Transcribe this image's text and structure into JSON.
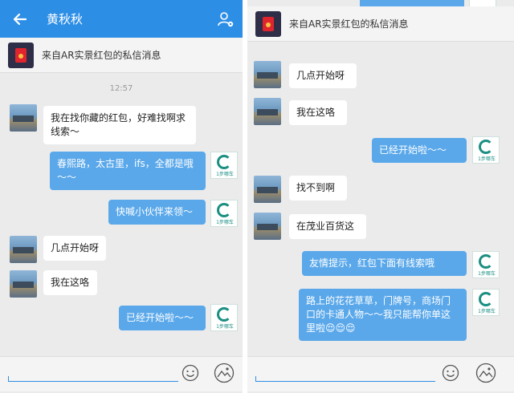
{
  "left": {
    "header": {
      "title": "黄秋秋",
      "back_icon": "arrow-left-icon",
      "contact_icon": "contact-icon"
    },
    "notice": "来自AR实景红包的私信消息",
    "timestamp": "12:57",
    "messages": [
      {
        "side": "in",
        "text": "我在找你藏的红包，好难找啊求线索～"
      },
      {
        "side": "out",
        "text": "春熙路，太古里，ifs，全都是哦～～"
      },
      {
        "side": "out",
        "text": "快喊小伙伴来领～"
      },
      {
        "side": "in",
        "text": "几点开始呀"
      },
      {
        "side": "in",
        "text": "我在这咯"
      },
      {
        "side": "out",
        "text": "已经开始啦～～"
      }
    ]
  },
  "right": {
    "notice": "来自AR实景红包的私信消息",
    "messages": [
      {
        "side": "in",
        "text": "几点开始呀"
      },
      {
        "side": "in",
        "text": "我在这咯"
      },
      {
        "side": "out",
        "text": "已经开始啦～～"
      },
      {
        "side": "in",
        "text": "找不到啊"
      },
      {
        "side": "in",
        "text": "在茂业百货这"
      },
      {
        "side": "out",
        "text": "友情提示，红包下面有线索哦"
      },
      {
        "side": "out",
        "text": "路上的花花草草，门牌号，商场门口的卡通人物～～我只能帮你单这里啦😌😌😌"
      }
    ]
  },
  "sender_logo_caption": "1步哪车",
  "colors": {
    "accent": "#2d8ee6",
    "outgoing_bubble": "#5aa8ea",
    "incoming_bubble": "#ffffff",
    "background": "#ebebeb"
  },
  "icons": {
    "emoji": "smiley-icon",
    "image": "image-icon"
  }
}
